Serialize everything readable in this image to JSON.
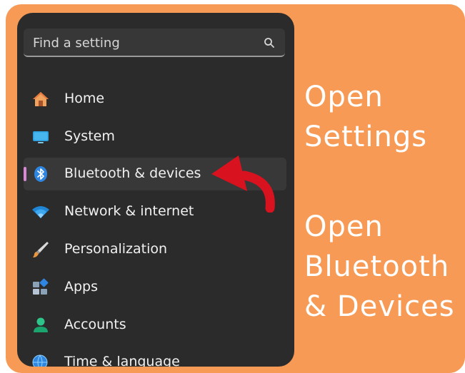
{
  "search": {
    "placeholder": "Find a setting",
    "icon": "search-icon"
  },
  "nav": {
    "items": [
      {
        "label": "Home",
        "icon": "home-icon",
        "selected": false
      },
      {
        "label": "System",
        "icon": "monitor-icon",
        "selected": false
      },
      {
        "label": "Bluetooth & devices",
        "icon": "bluetooth-icon",
        "selected": true
      },
      {
        "label": "Network & internet",
        "icon": "wifi-icon",
        "selected": false
      },
      {
        "label": "Personalization",
        "icon": "brush-icon",
        "selected": false
      },
      {
        "label": "Apps",
        "icon": "apps-icon",
        "selected": false
      },
      {
        "label": "Accounts",
        "icon": "person-icon",
        "selected": false
      },
      {
        "label": "Time & language",
        "icon": "globe-clock-icon",
        "selected": false
      }
    ]
  },
  "annotations": {
    "step1": [
      "Open",
      "Settings"
    ],
    "step2": [
      "Open",
      "Bluetooth",
      "& Devices"
    ]
  },
  "colors": {
    "background": "#f79a55",
    "panel": "#2b2b2b",
    "selected_row": "#383838",
    "selection_indicator": "#d987d6",
    "arrow": "#d8121e",
    "annotation_text": "#ffffff"
  }
}
